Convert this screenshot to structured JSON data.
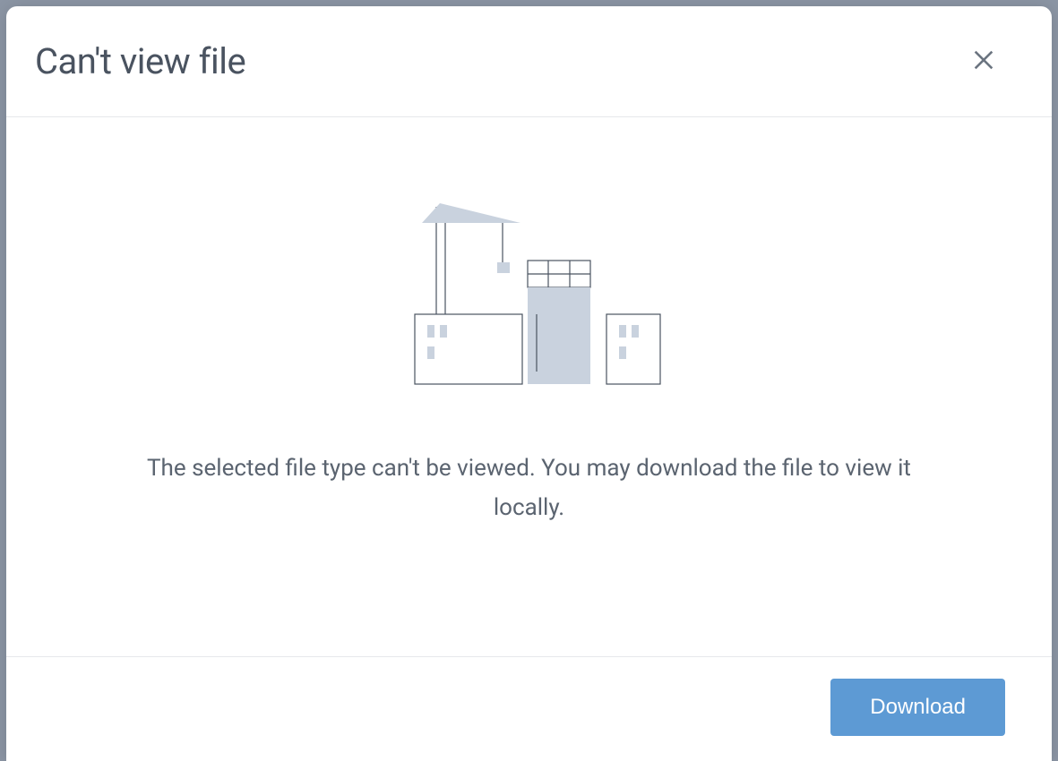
{
  "modal": {
    "title": "Can't view file",
    "message": "The selected file type can't be viewed. You may download the file to view it locally.",
    "download_label": "Download"
  }
}
